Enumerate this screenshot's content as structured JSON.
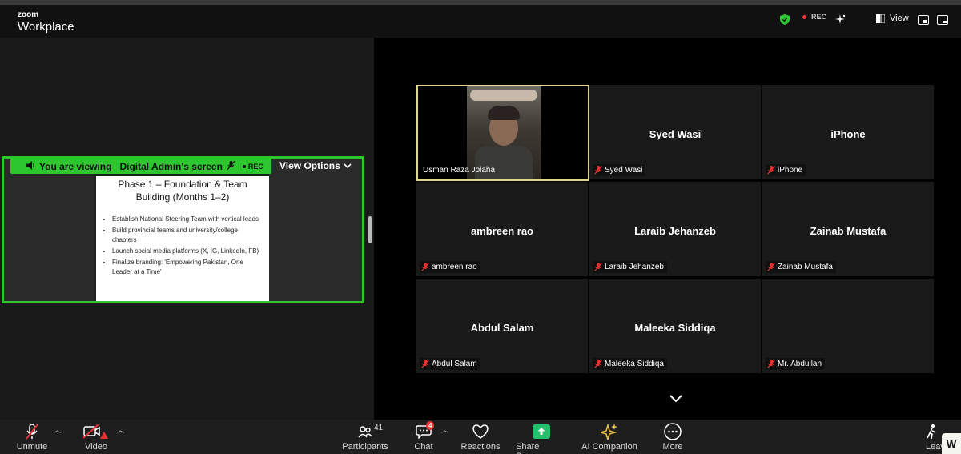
{
  "app": {
    "brand_top": "zoom",
    "brand_bottom": "Workplace"
  },
  "header": {
    "rec_label": "REC",
    "view_label": "View"
  },
  "share": {
    "viewing_text": "You are viewing",
    "sharer": "Digital Admin's screen",
    "rec_label": "REC",
    "view_options": "View Options",
    "slide_title": "Phase 1 – Foundation & Team Building (Months 1–2)",
    "bullets": [
      "Establish National Steering Team with vertical leads",
      "Build provincial teams and university/college chapters",
      "Launch social media platforms (X, IG, LinkedIn, FB)",
      "Finalize branding: 'Empowering Pakistan, One Leader at a Time'"
    ]
  },
  "participants_grid": [
    {
      "name": "",
      "label": "Usman Raza Jolaha",
      "muted": false,
      "video": true
    },
    {
      "name": "Syed Wasi",
      "label": "Syed Wasi",
      "muted": true
    },
    {
      "name": "iPhone",
      "label": "iPhone",
      "muted": true
    },
    {
      "name": "ambreen rao",
      "label": "ambreen rao",
      "muted": true
    },
    {
      "name": "Laraib Jehanzeb",
      "label": "Laraib Jehanzeb",
      "muted": true
    },
    {
      "name": "Zainab Mustafa",
      "label": "Zainab Mustafa",
      "muted": true
    },
    {
      "name": "Abdul Salam",
      "label": "Abdul Salam",
      "muted": true
    },
    {
      "name": "Maleeka Siddiqa",
      "label": "Maleeka Siddiqa",
      "muted": true
    },
    {
      "name": "",
      "label": "Mr. Abdullah",
      "muted": true
    }
  ],
  "toolbar": {
    "unmute": "Unmute",
    "video": "Video",
    "participants": "Participants",
    "participants_count": "41",
    "chat": "Chat",
    "chat_badge": "4",
    "reactions": "Reactions",
    "share_screen": "Share Screen",
    "ai_companion": "AI Companion",
    "more": "More",
    "leave": "Leave",
    "corner_logo": "W"
  },
  "colors": {
    "accent_green": "#2ec62e",
    "share_green": "#23c16b",
    "mute_red": "#e33333",
    "active_border": "#e0d68a"
  }
}
